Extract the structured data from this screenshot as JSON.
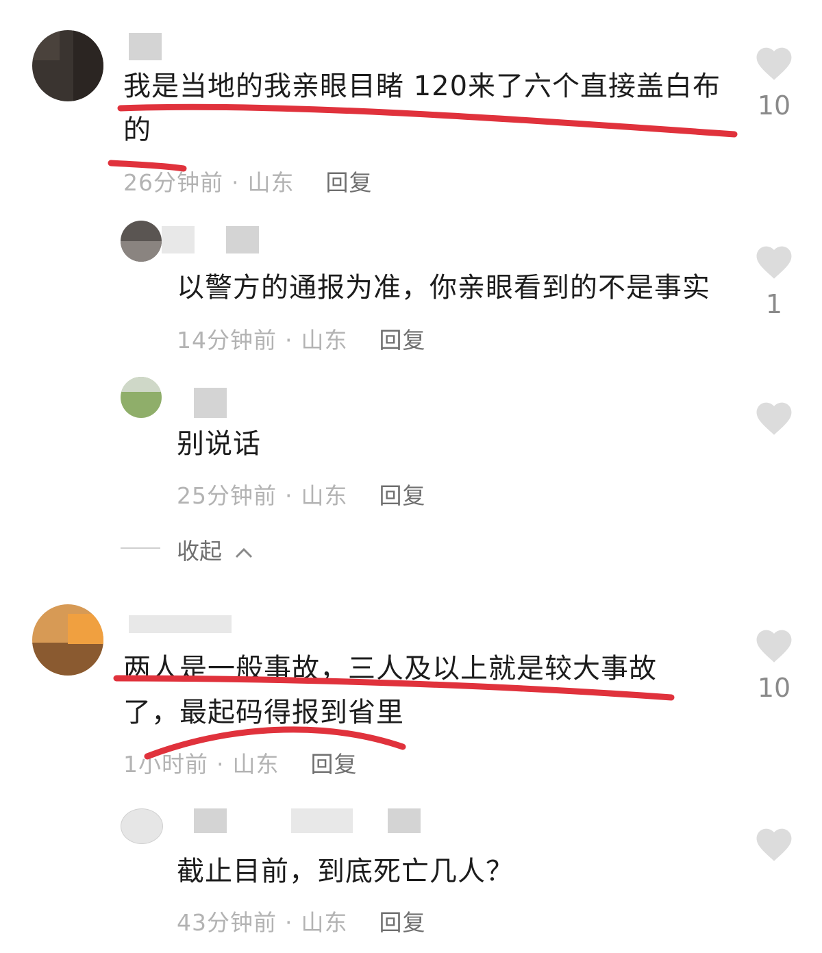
{
  "comments": [
    {
      "text": "我是当地的我亲眼目睹 120来了六个直接盖白布的",
      "time": "26分钟前",
      "location": "山东",
      "reply_label": "回复",
      "likes": "10",
      "replies": [
        {
          "text": "以警方的通报为准，你亲眼看到的不是事实",
          "time": "14分钟前",
          "location": "山东",
          "reply_label": "回复",
          "likes": "1"
        },
        {
          "text": "别说话",
          "time": "25分钟前",
          "location": "山东",
          "reply_label": "回复",
          "likes": ""
        }
      ],
      "collapse_label": "收起"
    },
    {
      "text": "两人是一般事故，三人及以上就是较大事故了，最起码得报到省里",
      "time": "1小时前",
      "location": "山东",
      "reply_label": "回复",
      "likes": "10",
      "replies": [
        {
          "text": "截止目前，到底死亡几人？",
          "time": "43分钟前",
          "location": "山东",
          "reply_label": "回复",
          "likes": ""
        }
      ]
    }
  ],
  "colors": {
    "underline": "#e0323c",
    "heart": "#dcdcdc",
    "meta": "#b3b3b3",
    "reply": "#6f6f6f"
  }
}
